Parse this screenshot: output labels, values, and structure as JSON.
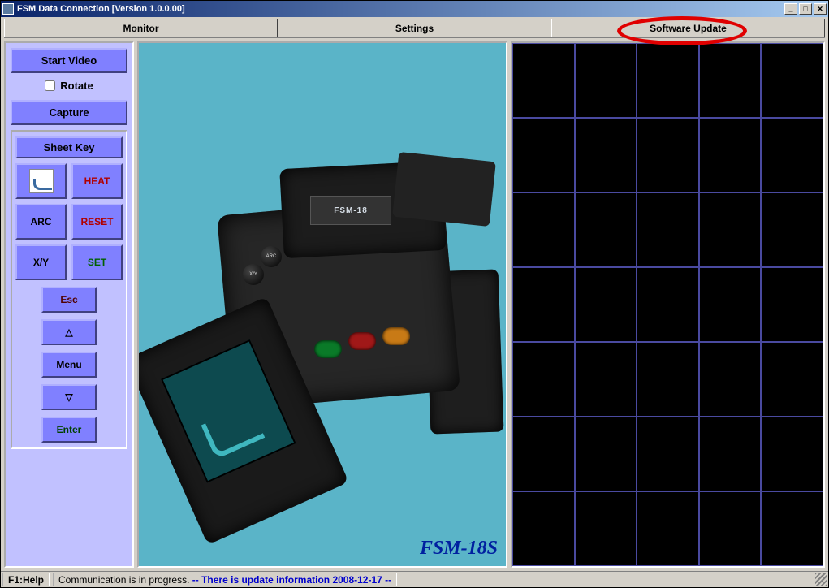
{
  "window": {
    "title": "FSM Data Connection [Version 1.0.0.00]"
  },
  "tabs": {
    "monitor": "Monitor",
    "settings": "Settings",
    "software_update": "Software Update"
  },
  "sidebar": {
    "start_video": "Start Video",
    "rotate": "Rotate",
    "capture": "Capture"
  },
  "sheetkey": {
    "header": "Sheet Key",
    "heat": "HEAT",
    "arc": "ARC",
    "reset": "RESET",
    "xy": "X/Y",
    "set": "SET",
    "esc": "Esc",
    "up": "△",
    "menu": "Menu",
    "down": "▽",
    "enter": "Enter"
  },
  "image": {
    "model_label": "FSM-18S",
    "device_badge": "FSM-18"
  },
  "status": {
    "help": "F1:Help",
    "comm": "Communication is in progress.",
    "update": "-- There is update information 2008-12-17 --"
  },
  "winbuttons": {
    "min": "_",
    "max": "□",
    "close": "✕"
  }
}
